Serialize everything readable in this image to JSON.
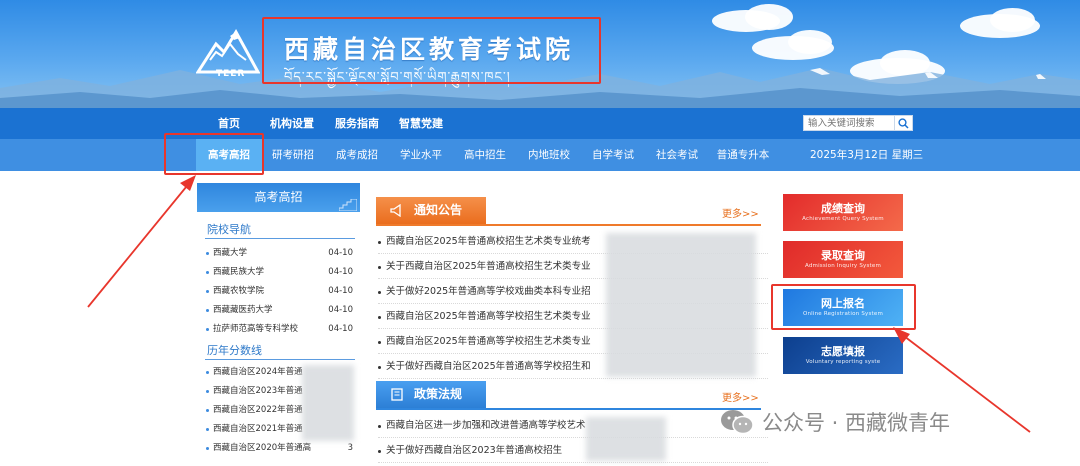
{
  "header": {
    "title": "西藏自治区教育考试院",
    "subtitle_tibetan": "བོད་རང་སྐྱོང་ལྗོངས་སློབ་གསོ་ཡིག་རྒྱུགས་ཁང་།",
    "logo_text": "TEER"
  },
  "nav_primary": [
    "首页",
    "机构设置",
    "服务指南",
    "智慧党建"
  ],
  "search": {
    "placeholder": "输入关键词搜索"
  },
  "nav_secondary": [
    "高考高招",
    "研考研招",
    "成考成招",
    "学业水平",
    "高中招生",
    "内地班校",
    "自学考试",
    "社会考试",
    "普通专升本"
  ],
  "date": "2025年3月12日 星期三",
  "left_panel": {
    "title": "高考高招",
    "section1": "院校导航",
    "schools": [
      {
        "name": "西藏大学",
        "date": "04-10"
      },
      {
        "name": "西藏民族大学",
        "date": "04-10"
      },
      {
        "name": "西藏农牧学院",
        "date": "04-10"
      },
      {
        "name": "西藏藏医药大学",
        "date": "04-10"
      },
      {
        "name": "拉萨师范高等专科学校",
        "date": "04-10"
      }
    ],
    "section2": "历年分数线",
    "scores": [
      "西藏自治区2024年普通",
      "西藏自治区2023年普通",
      "西藏自治区2022年普通",
      "西藏自治区2021年普通",
      "西藏自治区2020年普通高"
    ],
    "scores_tail": "3"
  },
  "notice": {
    "title": "通知公告",
    "more": "更多>>",
    "items": [
      "西藏自治区2025年普通高校招生艺术类专业统考",
      "关于西藏自治区2025年普通高校招生艺术类专业",
      "关于做好2025年普通高等学校戏曲类本科专业招",
      "西藏自治区2025年普通高等学校招生艺术类专业",
      "西藏自治区2025年普通高等学校招生艺术类专业",
      "关于做好西藏自治区2025年普通高等学校招生和"
    ]
  },
  "policy": {
    "title": "政策法规",
    "more": "更多>>",
    "items": [
      "西藏自治区进一步加强和改进普通高等学校艺术",
      "关于做好西藏自治区2023年普通高校招生"
    ]
  },
  "quick_links": [
    {
      "cn": "成绩查询",
      "en": "Achievement Query System"
    },
    {
      "cn": "录取查询",
      "en": "Admission Inquiry System"
    },
    {
      "cn": "网上报名",
      "en": "Online Registration System"
    },
    {
      "cn": "志愿填报",
      "en": "Voluntary reporting syste"
    }
  ],
  "watermark": "公众号 · 西藏微青年",
  "colors": {
    "nav_primary": "#1b72d2",
    "nav_secondary": "#3f8fe2",
    "notice_tab": "#ef7a2b",
    "policy_tab": "#2f86de",
    "annotation_red": "#e8362c"
  }
}
